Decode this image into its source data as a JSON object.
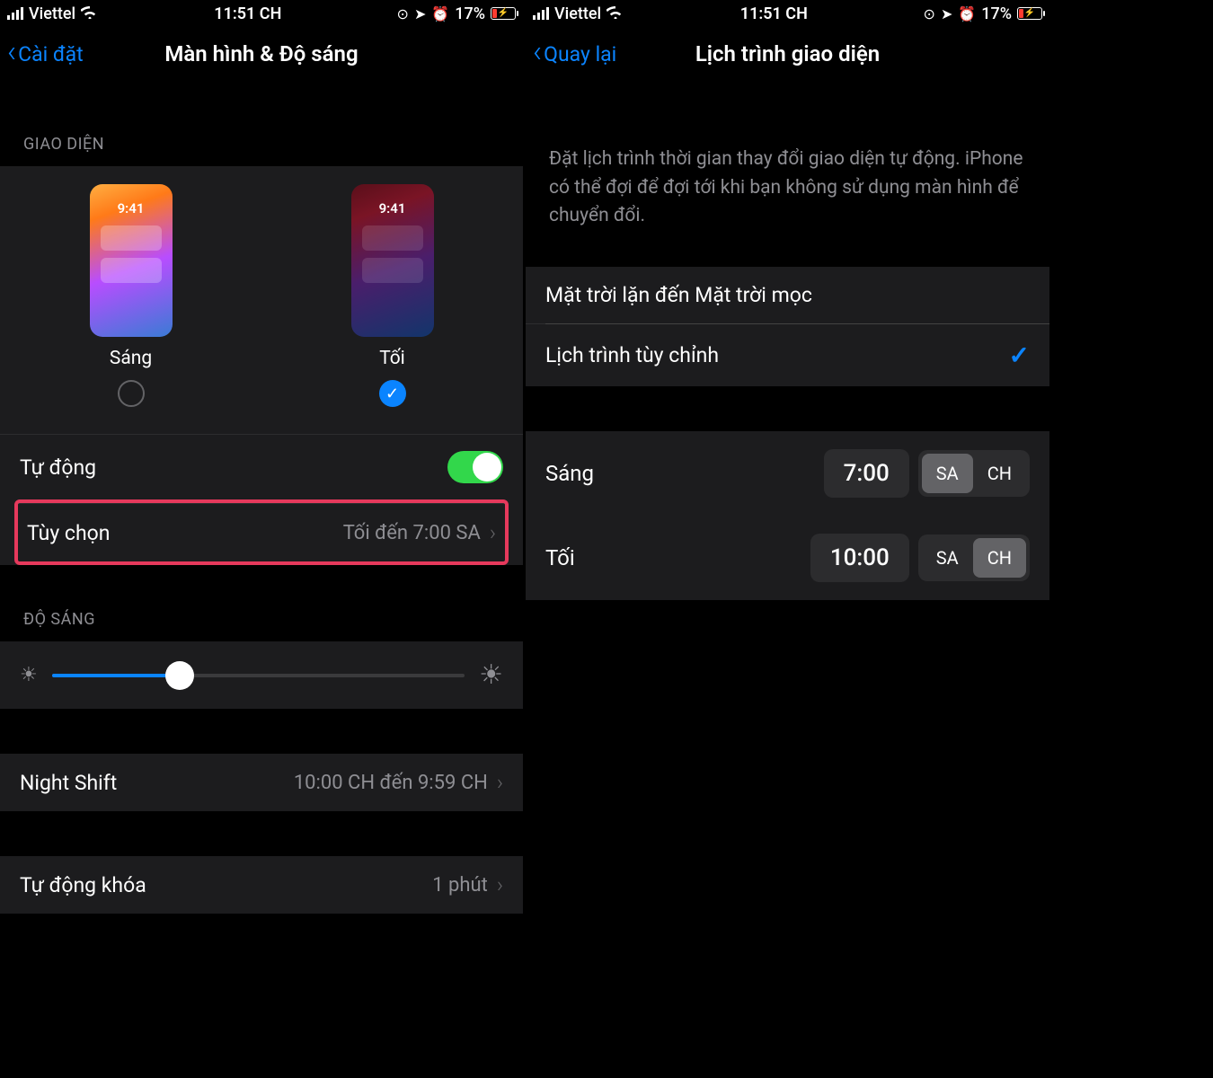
{
  "status": {
    "carrier": "Viettel",
    "time": "11:51 CH",
    "battery_pct": "17%"
  },
  "left": {
    "back_label": "Cài đặt",
    "title": "Màn hình & Độ sáng",
    "appearance_header": "GIAO DIỆN",
    "thumb_time": "9:41",
    "light_label": "Sáng",
    "dark_label": "Tối",
    "automatic_label": "Tự động",
    "options_label": "Tùy chọn",
    "options_value": "Tối đến 7:00 SA",
    "brightness_header": "ĐỘ SÁNG",
    "night_shift_label": "Night Shift",
    "night_shift_value": "10:00 CH đến 9:59 CH",
    "auto_lock_label": "Tự động khóa",
    "auto_lock_value": "1 phút"
  },
  "right": {
    "back_label": "Quay lại",
    "title": "Lịch trình giao diện",
    "description": "Đặt lịch trình thời gian thay đổi giao diện tự động. iPhone có thể đợi để đợi tới khi bạn không sử dụng màn hình để chuyển đổi.",
    "sunset_label": "Mặt trời lặn đến Mặt trời mọc",
    "custom_label": "Lịch trình tùy chỉnh",
    "light_row_label": "Sáng",
    "light_time": "7:00",
    "dark_row_label": "Tối",
    "dark_time": "10:00",
    "seg_am": "SA",
    "seg_pm": "CH"
  }
}
